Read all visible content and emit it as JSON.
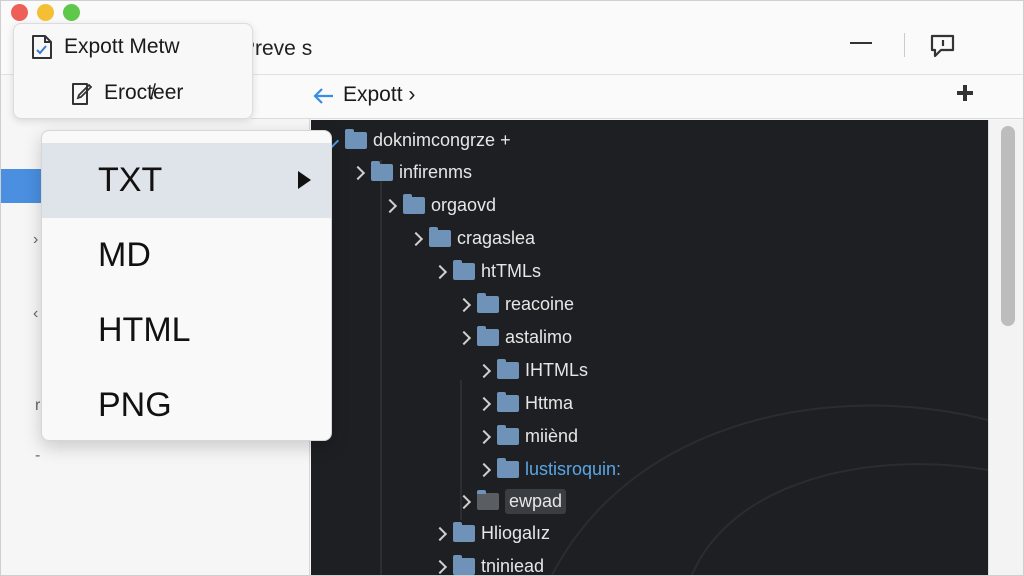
{
  "window": {
    "controls": [
      "close",
      "minimize",
      "maximize"
    ]
  },
  "titlebar": {
    "preview_label": "Preve s",
    "minimize_icon": "minimize-icon",
    "chat_icon": "chat-bubble-icon"
  },
  "export_card": {
    "item1_label": "Expott Metw",
    "item2_label": "Eroct̸eer"
  },
  "breadcrumb": {
    "label": "Expott ›"
  },
  "dropdown": {
    "items": [
      "TXT",
      "MD",
      "HTML",
      "PNG"
    ],
    "active_index": 0
  },
  "tree": {
    "nodes": [
      {
        "label": "doknimcongrze +",
        "depth": 0,
        "state": "open"
      },
      {
        "label": "infirenms",
        "depth": 1,
        "state": "closed"
      },
      {
        "label": "orgaovd",
        "depth": 2,
        "state": "closed"
      },
      {
        "label": "cragaslea",
        "depth": 3,
        "state": "closed"
      },
      {
        "label": "htTMLs",
        "depth": 4,
        "state": "closed"
      },
      {
        "label": "reacoine",
        "depth": 5,
        "state": "closed"
      },
      {
        "label": "astalimo",
        "depth": 5,
        "state": "closed"
      },
      {
        "label": "IHTMLs",
        "depth": 6,
        "state": "closed"
      },
      {
        "label": "Httma",
        "depth": 6,
        "state": "closed"
      },
      {
        "label": "miiènd",
        "depth": 6,
        "state": "closed"
      },
      {
        "label": "lustisroquin:",
        "depth": 6,
        "state": "closed",
        "link": true
      },
      {
        "label": "ewpad",
        "depth": 5,
        "state": "file",
        "selected": true
      },
      {
        "label": "Hliogalız",
        "depth": 4,
        "state": "closed"
      },
      {
        "label": "tniniead",
        "depth": 4,
        "state": "closed"
      }
    ]
  },
  "colors": {
    "accent": "#4a8fe0",
    "tree_bg": "#1d1f22",
    "folder": "#6f92b8",
    "link": "#5aa6e6"
  }
}
